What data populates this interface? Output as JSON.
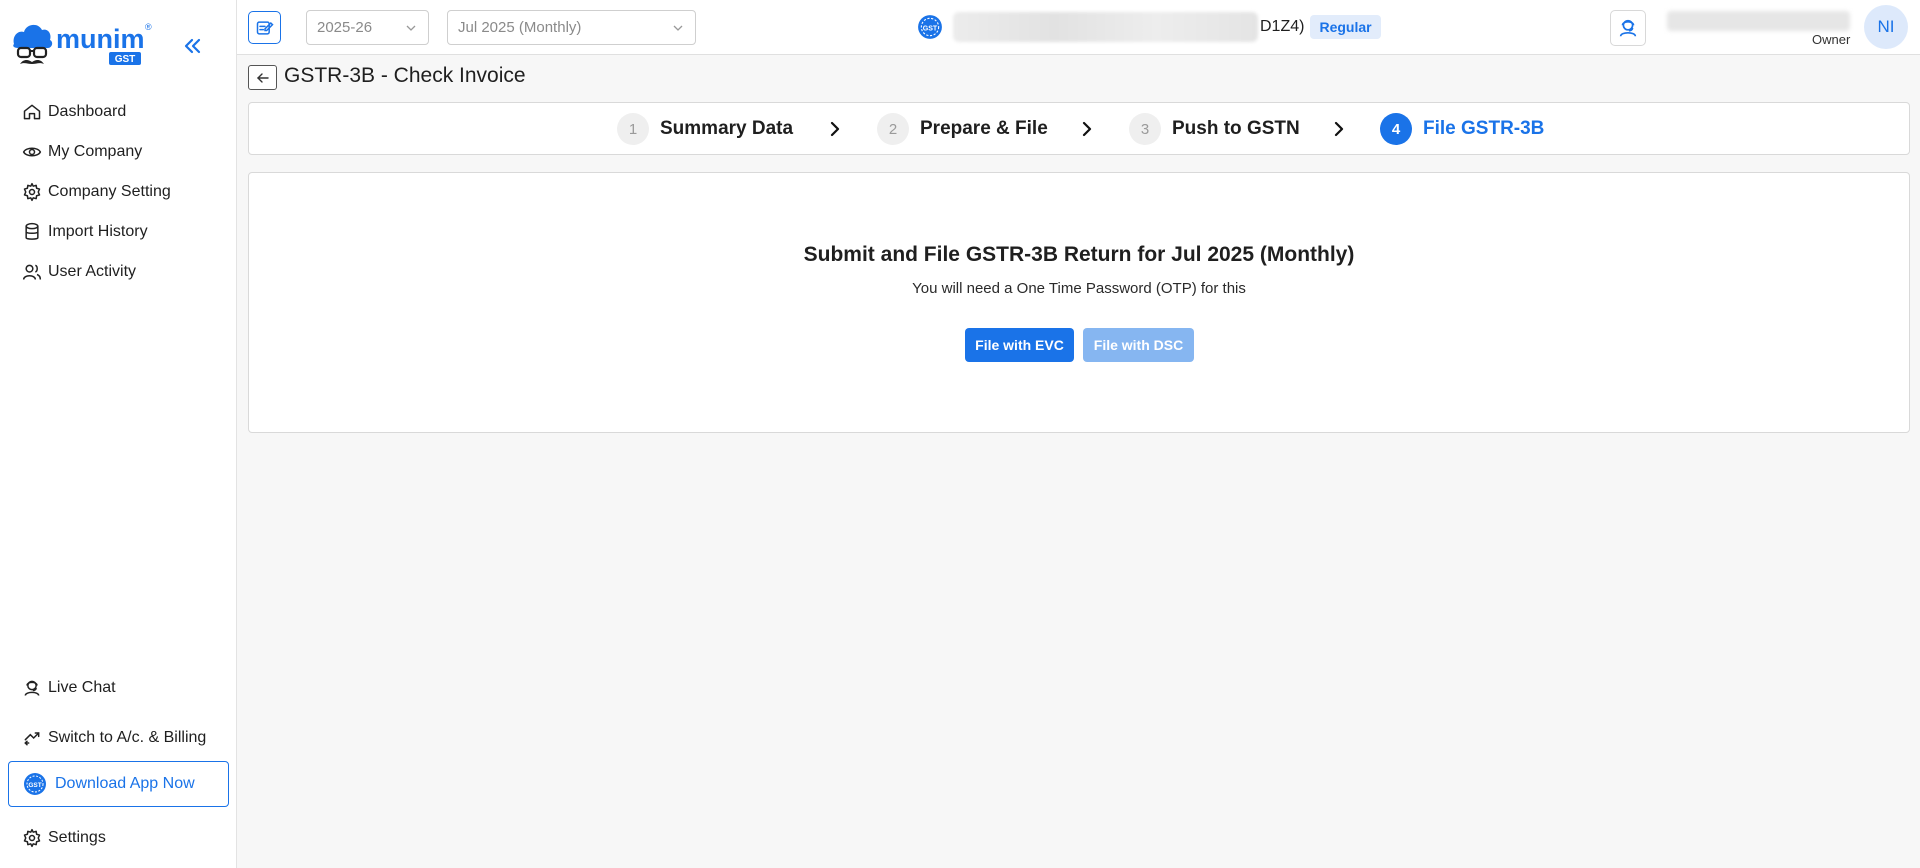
{
  "brand": {
    "name": "munim",
    "tag": "GST",
    "registered": "®"
  },
  "sidebar": {
    "items": [
      {
        "label": "Dashboard",
        "icon": "home-icon"
      },
      {
        "label": "My Company",
        "icon": "eye-icon"
      },
      {
        "label": "Company Setting",
        "icon": "gear-icon"
      },
      {
        "label": "Import History",
        "icon": "database-icon"
      },
      {
        "label": "User Activity",
        "icon": "users-icon"
      }
    ],
    "bottom": {
      "live_chat": "Live Chat",
      "switch": "Switch to A/c. & Billing",
      "download": "Download App Now",
      "settings": "Settings"
    }
  },
  "topbar": {
    "year": "2025-26",
    "period": "Jul 2025 (Monthly)",
    "gstin_tail": "D1Z4)",
    "company_type": "Regular",
    "user_role": "Owner",
    "avatar_initials": "NI"
  },
  "page": {
    "title": "GSTR-3B - Check Invoice"
  },
  "steps": [
    {
      "num": "1",
      "label": "Summary Data",
      "active": false
    },
    {
      "num": "2",
      "label": "Prepare & File",
      "active": false
    },
    {
      "num": "3",
      "label": "Push to GSTN",
      "active": false
    },
    {
      "num": "4",
      "label": "File GSTR-3B",
      "active": true
    }
  ],
  "file_card": {
    "heading": "Submit and File GSTR-3B Return for Jul 2025 (Monthly)",
    "subtext": "You will need a One Time Password (OTP) for this",
    "evc_label": "File with EVC",
    "dsc_label": "File with DSC"
  },
  "colors": {
    "accent": "#1a73e8",
    "accent_light": "#86b6f1",
    "badge_bg": "#e2ecfb",
    "background": "#f7f7f7"
  }
}
